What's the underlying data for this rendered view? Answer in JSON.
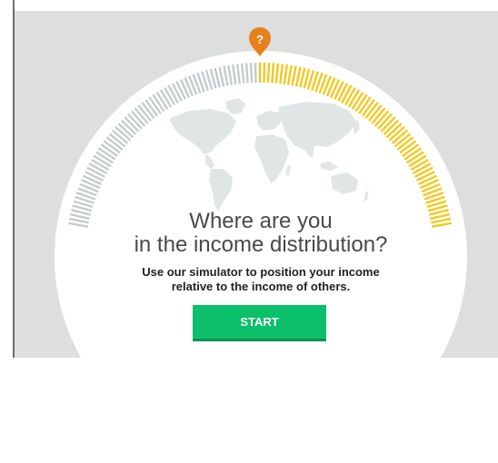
{
  "marker": {
    "icon": "question-marker-icon",
    "label": "?",
    "color": "#e8811c"
  },
  "gauge": {
    "left_color": "#c5ccce",
    "right_color": "#f3c822",
    "highlight_fraction": 0.5
  },
  "map": {
    "icon": "world-map-icon",
    "color": "#e0e5e5"
  },
  "heading": {
    "line1": "Where are you",
    "line2": "in the income distribution?"
  },
  "subheading": {
    "line1": "Use our simulator to position your income",
    "line2": "relative to the income of others."
  },
  "start_button": {
    "label": "START",
    "color": "#0cbf6a"
  }
}
